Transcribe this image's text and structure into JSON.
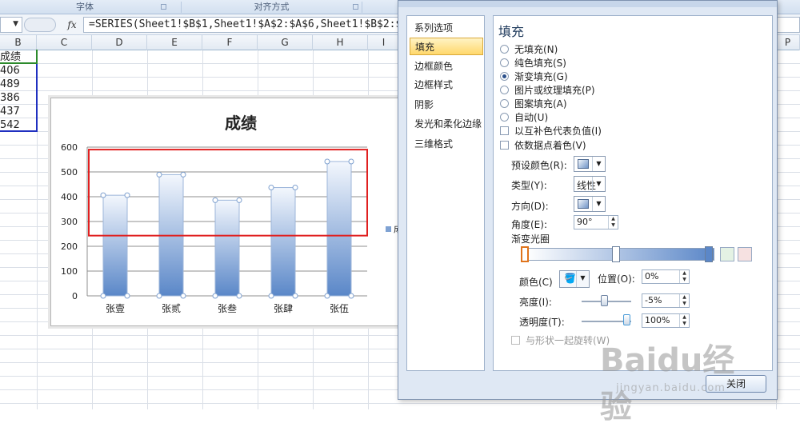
{
  "ribbon": {
    "groups": [
      "字体",
      "对齐方式"
    ]
  },
  "formula_bar": {
    "fx_label": "fx",
    "formula": "=SERIES(Sheet1!$B$1,Sheet1!$A$2:$A$6,Sheet1!$B$2:$"
  },
  "columns": [
    "B",
    "C",
    "D",
    "E",
    "F",
    "G",
    "H",
    "I",
    "P"
  ],
  "sheet": {
    "b_column": [
      "成绩",
      "406",
      "489",
      "386",
      "437",
      "542"
    ]
  },
  "chart_data": {
    "type": "bar",
    "title": "成绩",
    "categories": [
      "张壹",
      "张贰",
      "张叁",
      "张肆",
      "张伍"
    ],
    "series": [
      {
        "name": "成",
        "values": [
          406,
          489,
          386,
          437,
          542
        ]
      }
    ],
    "ylim": [
      0,
      600
    ],
    "yticks": [
      "0",
      "100",
      "200",
      "300",
      "400",
      "500",
      "600"
    ],
    "grid": true,
    "legend": "right",
    "bar_fill": "gradient #f0f5fc to #5a87c8",
    "highlight_box_color": "#e02020"
  },
  "dialog": {
    "nav_items": [
      "系列选项",
      "填充",
      "边框颜色",
      "边框样式",
      "阴影",
      "发光和柔化边缘",
      "三维格式"
    ],
    "active_nav": "填充",
    "heading": "填充",
    "fill_options": [
      {
        "label": "无填充(N)",
        "selected": false
      },
      {
        "label": "纯色填充(S)",
        "selected": false
      },
      {
        "label": "渐变填充(G)",
        "selected": true
      },
      {
        "label": "图片或纹理填充(P)",
        "selected": false
      },
      {
        "label": "图案填充(A)",
        "selected": false
      },
      {
        "label": "自动(U)",
        "selected": false
      }
    ],
    "checkbox_invert": "以互补色代表负值(I)",
    "checkbox_vary": "依数据点着色(V)",
    "preset_color_label": "预设颜色(R):",
    "type_label": "类型(Y):",
    "type_value": "线性",
    "direction_label": "方向(D):",
    "angle_label": "角度(E):",
    "angle_value": "90°",
    "gradient_stops_label": "渐变光圈",
    "color_label": "颜色(C)",
    "position_label": "位置(O):",
    "position_value": "0%",
    "brightness_label": "亮度(I):",
    "brightness_value": "-5%",
    "transparency_label": "透明度(T):",
    "transparency_value": "100%",
    "rotate_with_shape": "与形状一起旋转(W)",
    "close_button": "关闭"
  },
  "watermark": {
    "main": "Baidu经验",
    "sub": "jingyan.baidu.com"
  }
}
